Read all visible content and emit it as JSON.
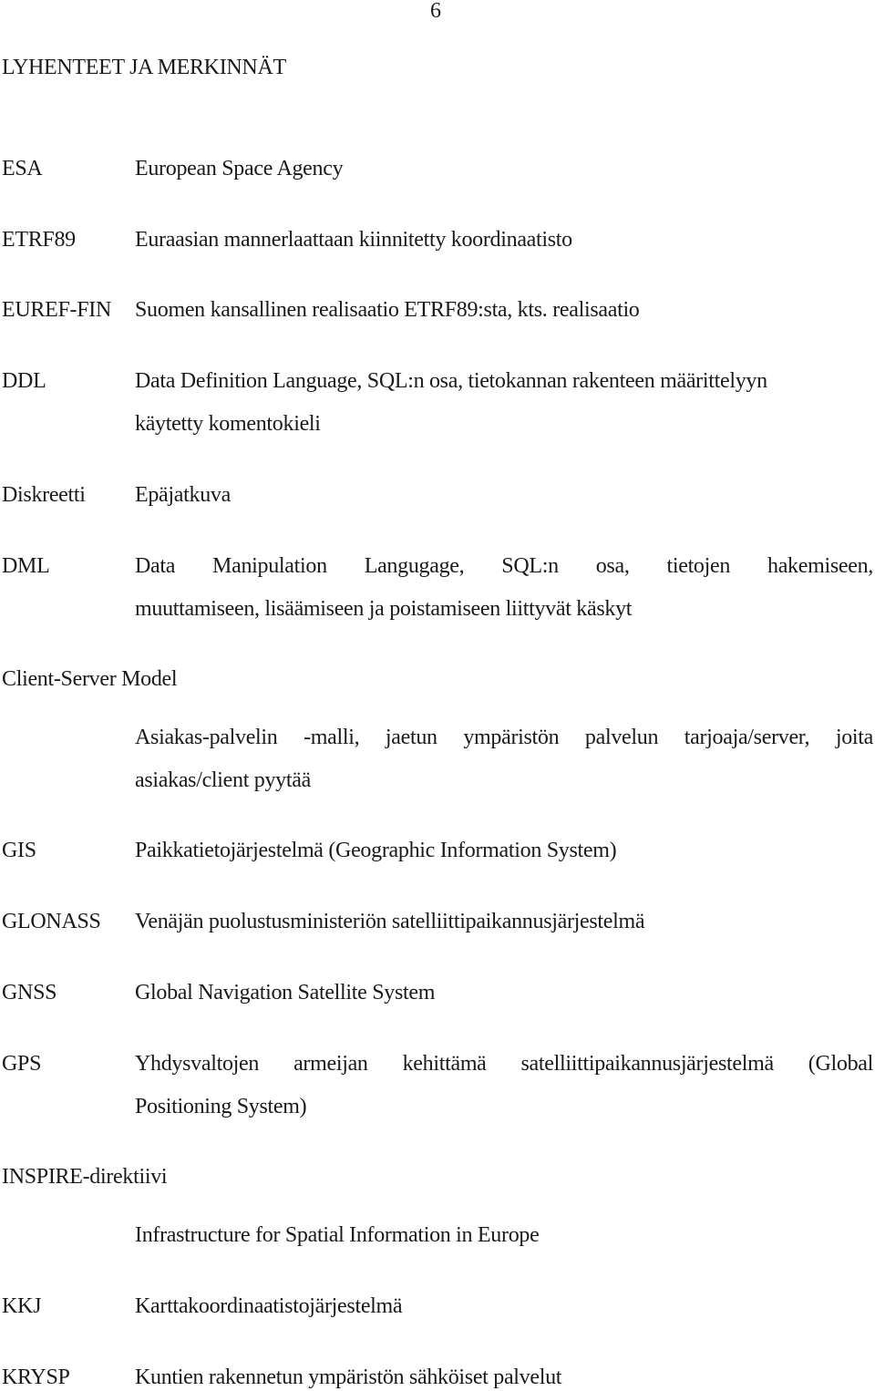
{
  "page_number": "6",
  "heading": "LYHENTEET JA MERKINNÄT",
  "entries": [
    {
      "term": "ESA",
      "definition": [
        "European Space Agency"
      ]
    },
    {
      "term": "ETRF89",
      "definition": [
        "Euraasian mannerlaattaan kiinnitetty koordinaatisto"
      ]
    },
    {
      "term": "EUREF-FIN",
      "definition": [
        "Suomen kansallinen realisaatio ETRF89:sta, kts. realisaatio"
      ]
    },
    {
      "term": "DDL",
      "definition": [
        "Data Definition Language, SQL:n osa, tietokannan rakenteen määrittelyyn",
        "käytetty komentokieli"
      ]
    },
    {
      "term": "Diskreetti",
      "definition": [
        "Epäjatkuva"
      ]
    },
    {
      "term": "DML",
      "definition": [
        "Data Manipulation Langugage, SQL:n osa, tietojen hakemiseen,",
        "muuttamiseen, lisäämiseen ja poistamiseen liittyvät käskyt"
      ]
    },
    {
      "term": "Client-Server Model",
      "definition": [
        "Asiakas-palvelin -malli, jaetun ympäristön palvelun tarjoaja/server, joita",
        "asiakas/client pyytää"
      ]
    },
    {
      "term": "GIS",
      "definition": [
        "Paikkatietojärjestelmä (Geographic Information System)"
      ]
    },
    {
      "term": "GLONASS",
      "definition": [
        "Venäjän puolustusministeriön satelliittipaikannusjärjestelmä"
      ]
    },
    {
      "term": "GNSS",
      "definition": [
        "Global Navigation Satellite System"
      ]
    },
    {
      "term": "GPS",
      "definition": [
        "Yhdysvaltojen armeijan kehittämä satelliittipaikannusjärjestelmä (Global",
        "Positioning System)"
      ]
    },
    {
      "term": "INSPIRE-direktiivi",
      "definition": [
        "Infrastructure for Spatial Information in Europe"
      ]
    },
    {
      "term": "KKJ",
      "definition": [
        "Karttakoordinaatistojärjestelmä"
      ]
    },
    {
      "term": "KRYSP",
      "definition": [
        "Kuntien rakennetun ympäristön sähköiset palvelut"
      ]
    }
  ]
}
